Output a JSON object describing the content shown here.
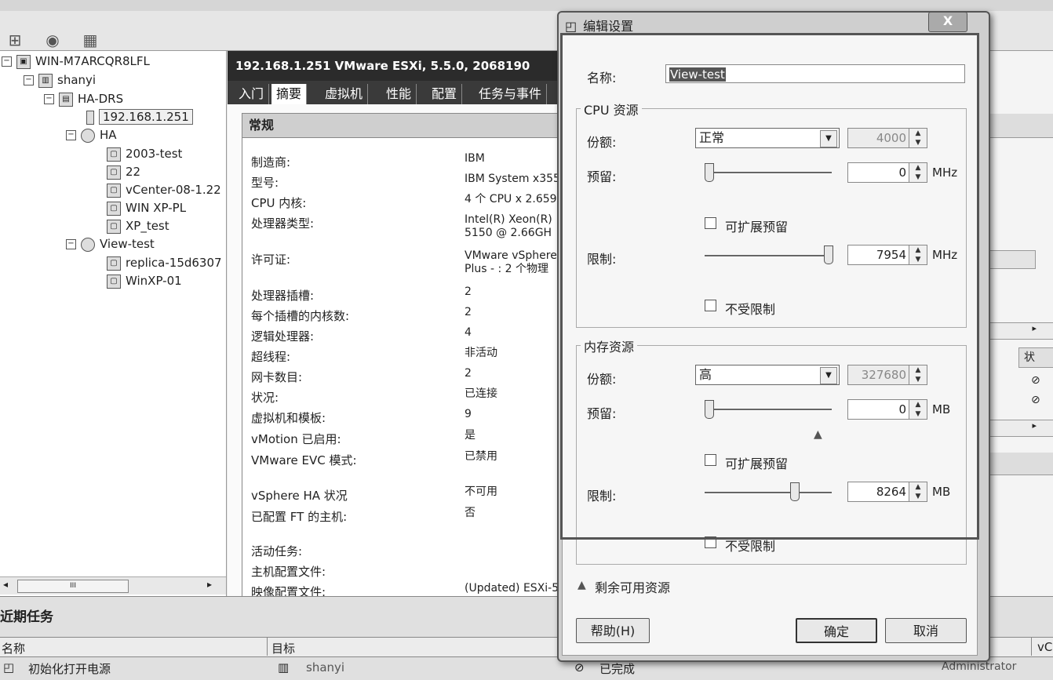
{
  "inventory": {
    "items": [
      {
        "label": "WIN-M7ARCQR8LFL"
      },
      {
        "label": "shanyi"
      },
      {
        "label": "HA-DRS"
      },
      {
        "label": "192.168.1.251"
      },
      {
        "label": "HA"
      },
      {
        "label": "2003-test"
      },
      {
        "label": "22"
      },
      {
        "label": "vCenter-08-1.22"
      },
      {
        "label": "WIN XP-PL"
      },
      {
        "label": "XP_test"
      },
      {
        "label": "View-test"
      },
      {
        "label": "replica-15d6307"
      },
      {
        "label": "WinXP-01"
      }
    ],
    "scroll_grip": "III"
  },
  "host": {
    "header": "192.168.1.251 VMware ESXi, 5.5.0, 2068190",
    "tabs": [
      "入门",
      "摘要",
      "虚拟机",
      "性能",
      "配置",
      "任务与事件"
    ],
    "active_tab": "摘要",
    "section_title": "常规",
    "properties": [
      {
        "label": "制造商:",
        "value": "IBM"
      },
      {
        "label": "型号:",
        "value": "IBM System x355"
      },
      {
        "label": "CPU 内核:",
        "value": "4 个 CPU x 2.659"
      },
      {
        "label": "处理器类型:",
        "value": "Intel(R) Xeon(R)\n5150 @ 2.66GH"
      },
      {
        "label": "许可证:",
        "value": "VMware vSphere\nPlus - : 2 个物理"
      },
      {
        "label": "处理器插槽:",
        "value": "2"
      },
      {
        "label": "每个插槽的内核数:",
        "value": "2"
      },
      {
        "label": "逻辑处理器:",
        "value": "4"
      },
      {
        "label": "超线程:",
        "value": "非活动"
      },
      {
        "label": "网卡数目:",
        "value": "2"
      },
      {
        "label": "状况:",
        "value": "已连接"
      },
      {
        "label": "虚拟机和模板:",
        "value": "9"
      },
      {
        "label": "vMotion 已启用:",
        "value": "是"
      },
      {
        "label": "VMware EVC 模式:",
        "value": "已禁用"
      },
      {
        "label": "vSphere HA 状况",
        "value": "不可用"
      },
      {
        "label": "已配置 FT 的主机:",
        "value": "否"
      },
      {
        "label": "活动任务:",
        "value": ""
      },
      {
        "label": "主机配置文件:",
        "value": ""
      },
      {
        "label": "映像配置文件:",
        "value": "(Updated) ESXi-5"
      }
    ]
  },
  "right_panel": {
    "status_col": "状"
  },
  "recent_tasks": {
    "title": "近期任务",
    "columns": [
      "名称",
      "目标",
      "vC"
    ],
    "rows": [
      {
        "name": "初始化打开电源",
        "target": "shanyi",
        "status": "已完成",
        "user": "Administrator"
      }
    ]
  },
  "dialog": {
    "title": "编辑设置",
    "close_label": "X",
    "name_label": "名称:",
    "name_value": "View-test",
    "cpu": {
      "group_label": "CPU 资源",
      "shares_label": "份额:",
      "shares_value": "正常",
      "shares_number": "4000",
      "reservation_label": "预留:",
      "reservation_value": "0",
      "reservation_unit": "MHz",
      "expandable_label": "可扩展预留",
      "limit_label": "限制:",
      "limit_value": "7954",
      "limit_unit": "MHz",
      "unlimited_label": "不受限制",
      "reservation_slider_fraction": 0.0,
      "limit_slider_fraction": 1.0
    },
    "memory": {
      "group_label": "内存资源",
      "shares_label": "份额:",
      "shares_value": "高",
      "shares_number": "327680",
      "reservation_label": "预留:",
      "reservation_value": "0",
      "reservation_unit": "MB",
      "expandable_label": "可扩展预留",
      "limit_label": "限制:",
      "limit_value": "8264",
      "limit_unit": "MB",
      "unlimited_label": "不受限制",
      "reservation_slider_fraction": 0.0,
      "limit_slider_fraction": 0.72
    },
    "remaining_label": "剩余可用资源",
    "help_button": "帮助(H)",
    "ok_button": "确定",
    "cancel_button": "取消"
  }
}
